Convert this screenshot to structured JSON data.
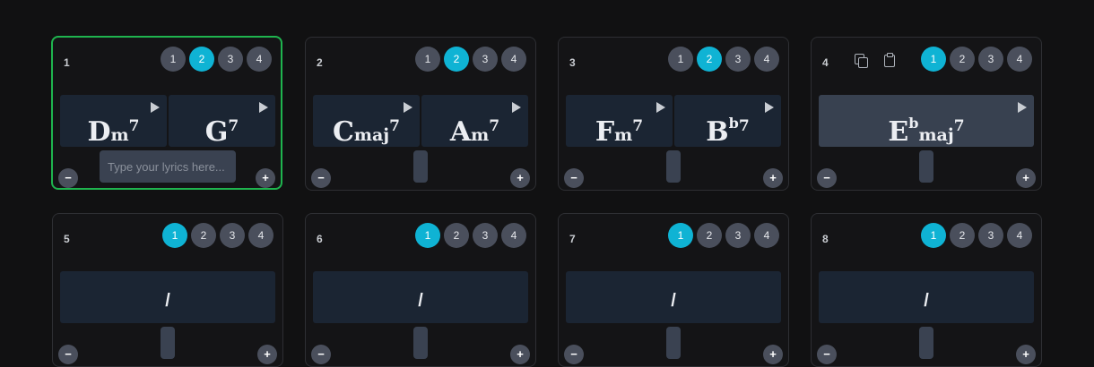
{
  "cards": [
    {
      "number": "1",
      "beats": [
        "1",
        "2",
        "3",
        "4"
      ],
      "active_beat": "2",
      "chords": [
        {
          "root": "D",
          "acc": "",
          "qual": "m",
          "ext": "7"
        },
        {
          "root": "G",
          "acc": "",
          "qual": "",
          "ext": "7"
        }
      ],
      "lyrics_placeholder": "Type your lyrics here..."
    },
    {
      "number": "2",
      "beats": [
        "1",
        "2",
        "3",
        "4"
      ],
      "active_beat": "2",
      "chords": [
        {
          "root": "C",
          "acc": "",
          "qual": "maj",
          "ext": "7"
        },
        {
          "root": "A",
          "acc": "",
          "qual": "m",
          "ext": "7"
        }
      ]
    },
    {
      "number": "3",
      "beats": [
        "1",
        "2",
        "3",
        "4"
      ],
      "active_beat": "2",
      "chords": [
        {
          "root": "F",
          "acc": "",
          "qual": "m",
          "ext": "7"
        },
        {
          "root": "B",
          "acc": "b",
          "qual": "",
          "ext": "7"
        }
      ]
    },
    {
      "number": "4",
      "beats": [
        "1",
        "2",
        "3",
        "4"
      ],
      "active_beat": "1",
      "chords": [
        {
          "root": "E",
          "acc": "b",
          "qual": "maj",
          "ext": "7"
        }
      ]
    },
    {
      "number": "5",
      "beats": [
        "1",
        "2",
        "3",
        "4"
      ],
      "active_beat": "1",
      "slash": "/"
    },
    {
      "number": "6",
      "beats": [
        "1",
        "2",
        "3",
        "4"
      ],
      "active_beat": "1",
      "slash": "/"
    },
    {
      "number": "7",
      "beats": [
        "1",
        "2",
        "3",
        "4"
      ],
      "active_beat": "1",
      "slash": "/"
    },
    {
      "number": "8",
      "beats": [
        "1",
        "2",
        "3",
        "4"
      ],
      "active_beat": "1",
      "slash": "/"
    }
  ],
  "buttons": {
    "minus": "−",
    "plus": "+"
  },
  "colors": {
    "selected_border": "#1fb44e",
    "active_beat": "#0fb3d4",
    "beat": "#4a4f5c",
    "chord_cell": "#1b2533",
    "chord_cell_selected": "#384150"
  },
  "icons": {
    "copy": "copy-icon",
    "paste": "clipboard-icon",
    "play": "play-icon"
  }
}
